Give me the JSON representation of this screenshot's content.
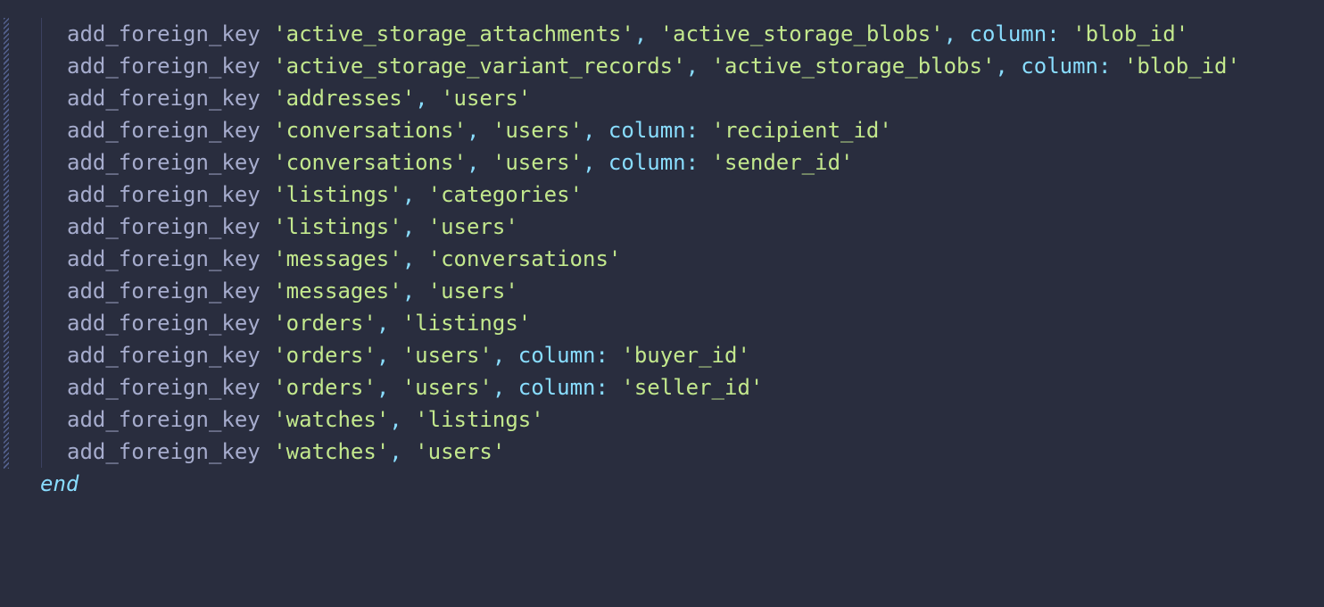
{
  "colors": {
    "background": "#292d3e",
    "method": "#a6accd",
    "punctuation": "#89ddff",
    "string": "#c3e88d",
    "keyword": "#89ddff"
  },
  "code": {
    "lines": [
      {
        "method": "add_foreign_key",
        "table": "active_storage_attachments",
        "ref": "active_storage_blobs",
        "opt": "column:",
        "opt_value": "blob_id"
      },
      {
        "method": "add_foreign_key",
        "table": "active_storage_variant_records",
        "ref": "active_storage_blobs",
        "opt": "column:",
        "opt_value": "blob_id"
      },
      {
        "method": "add_foreign_key",
        "table": "addresses",
        "ref": "users"
      },
      {
        "method": "add_foreign_key",
        "table": "conversations",
        "ref": "users",
        "opt": "column:",
        "opt_value": "recipient_id"
      },
      {
        "method": "add_foreign_key",
        "table": "conversations",
        "ref": "users",
        "opt": "column:",
        "opt_value": "sender_id"
      },
      {
        "method": "add_foreign_key",
        "table": "listings",
        "ref": "categories"
      },
      {
        "method": "add_foreign_key",
        "table": "listings",
        "ref": "users"
      },
      {
        "method": "add_foreign_key",
        "table": "messages",
        "ref": "conversations"
      },
      {
        "method": "add_foreign_key",
        "table": "messages",
        "ref": "users"
      },
      {
        "method": "add_foreign_key",
        "table": "orders",
        "ref": "listings"
      },
      {
        "method": "add_foreign_key",
        "table": "orders",
        "ref": "users",
        "opt": "column:",
        "opt_value": "buyer_id"
      },
      {
        "method": "add_foreign_key",
        "table": "orders",
        "ref": "users",
        "opt": "column:",
        "opt_value": "seller_id"
      },
      {
        "method": "add_foreign_key",
        "table": "watches",
        "ref": "listings"
      },
      {
        "method": "add_foreign_key",
        "table": "watches",
        "ref": "users"
      }
    ],
    "end_keyword": "end"
  }
}
